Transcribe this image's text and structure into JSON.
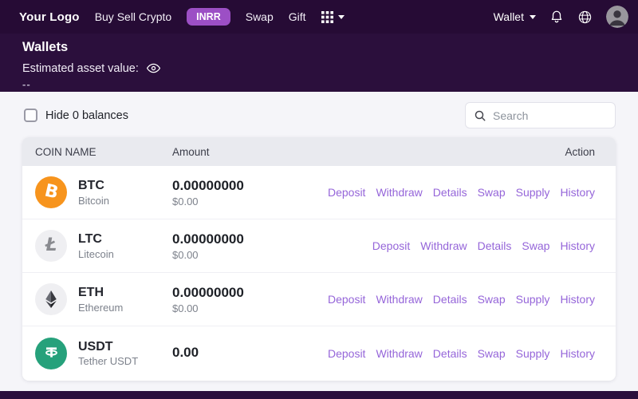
{
  "navbar": {
    "logo": "Your Logo",
    "buy_sell_label": "Buy Sell Crypto",
    "currency_badge": "INRR",
    "swap_label": "Swap",
    "gift_label": "Gift",
    "wallet_label": "Wallet"
  },
  "header": {
    "title": "Wallets",
    "estimated_asset_label": "Estimated asset value:",
    "estimated_asset_value": "--"
  },
  "controls": {
    "hide_zero_balances_label": "Hide 0 balances",
    "hide_zero_balances_checked": false,
    "search_placeholder": "Search"
  },
  "table": {
    "columns": [
      "COIN NAME",
      "Amount",
      "Action"
    ],
    "rows": [
      {
        "symbol": "BTC",
        "name": "Bitcoin",
        "amount": "0.00000000",
        "usd": "$0.00",
        "icon": "btc-icon",
        "icon_bg": "#f7941d",
        "actions": [
          "Deposit",
          "Withdraw",
          "Details",
          "Swap",
          "Supply",
          "History"
        ]
      },
      {
        "symbol": "LTC",
        "name": "Litecoin",
        "amount": "0.00000000",
        "usd": "$0.00",
        "icon": "ltc-icon",
        "icon_bg": "#efeff2",
        "actions": [
          "Deposit",
          "Withdraw",
          "Details",
          "Swap",
          "History"
        ]
      },
      {
        "symbol": "ETH",
        "name": "Ethereum",
        "amount": "0.00000000",
        "usd": "$0.00",
        "icon": "eth-icon",
        "icon_bg": "#efeff2",
        "actions": [
          "Deposit",
          "Withdraw",
          "Details",
          "Swap",
          "Supply",
          "History"
        ]
      },
      {
        "symbol": "USDT",
        "name": "Tether USDT",
        "amount": "0.00",
        "usd": "",
        "icon": "usdt-icon",
        "icon_bg": "#26a17b",
        "actions": [
          "Deposit",
          "Withdraw",
          "Details",
          "Swap",
          "Supply",
          "History"
        ]
      }
    ]
  },
  "colors": {
    "navbar_bg": "#260b35",
    "header_bg": "#2b0f3c",
    "badge_bg": "#9c4fc5",
    "action_link": "#9565d9",
    "table_header_bg": "#e9eaef",
    "page_bg": "#f5f5f9",
    "btc_orange": "#f7941d",
    "usdt_green": "#26a17b",
    "neutral_icon_bg": "#efeff2"
  }
}
